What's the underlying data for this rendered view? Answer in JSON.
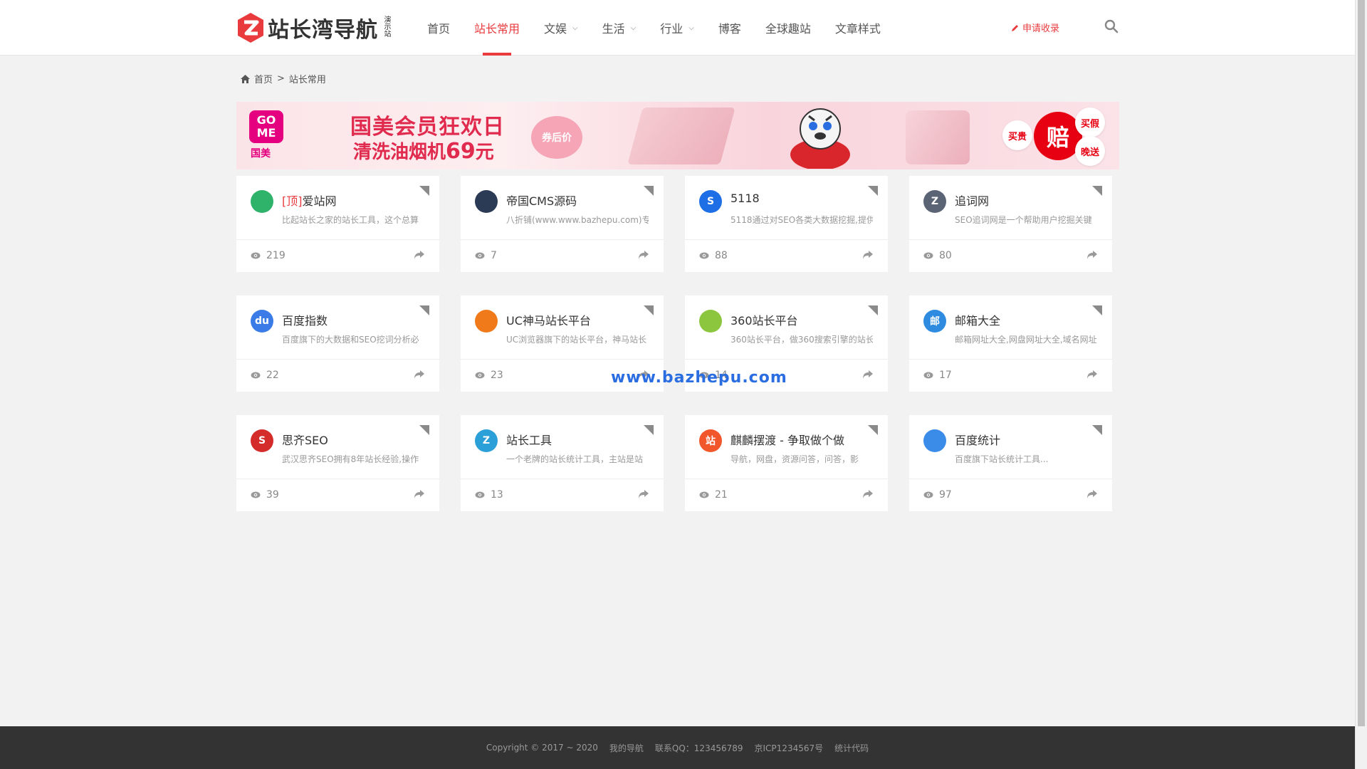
{
  "header": {
    "logo_text": "站长湾导航",
    "logo_sub": "演示站",
    "nav": [
      {
        "label": "首页",
        "active": false,
        "dropdown": false
      },
      {
        "label": "站长常用",
        "active": true,
        "dropdown": false
      },
      {
        "label": "文娱",
        "active": false,
        "dropdown": true
      },
      {
        "label": "生活",
        "active": false,
        "dropdown": true
      },
      {
        "label": "行业",
        "active": false,
        "dropdown": true
      },
      {
        "label": "博客",
        "active": false,
        "dropdown": false
      },
      {
        "label": "全球趣站",
        "active": false,
        "dropdown": false
      },
      {
        "label": "文章样式",
        "active": false,
        "dropdown": false
      }
    ],
    "apply_label": "申请收录",
    "accent_color": "#e93b3d"
  },
  "breadcrumb": {
    "home": "首页",
    "separator": ">",
    "current": "站长常用"
  },
  "banner": {
    "brand_logo": "GO\nME",
    "brand_name": "国美",
    "line1": "国美会员狂欢日",
    "line2_text": "清洗油烟机",
    "line2_price": "69",
    "line2_unit": "元",
    "coupon": "券后价",
    "badge_main": "赔",
    "badge_left": "买贵",
    "badge_right_top": "买假",
    "badge_right_bottom": "晚送"
  },
  "cards": [
    {
      "top_tag": "[顶]",
      "title": "爱站网",
      "desc": "比起站长之家的站长工具，这个总算",
      "views": "219",
      "icon": "aizhan-icon",
      "icon_text": "",
      "icon_color": "#2fb36b"
    },
    {
      "top_tag": "",
      "title": "帝国CMS源码",
      "desc": "八折铺(www.www.bazhepu.com)专",
      "views": "7",
      "icon": "empire-cms-icon",
      "icon_text": "",
      "icon_color": "#2b3a55"
    },
    {
      "top_tag": "",
      "title": "5118",
      "desc": "5118通过对SEO各类大数据挖掘,提供",
      "views": "88",
      "icon": "5118-icon",
      "icon_text": "S",
      "icon_color": "#1e6ee6"
    },
    {
      "top_tag": "",
      "title": "追词网",
      "desc": "SEO追词网是一个帮助用户挖掘关键",
      "views": "80",
      "icon": "zhuici-icon",
      "icon_text": "Z",
      "icon_color": "#5b6475"
    },
    {
      "top_tag": "",
      "title": "百度指数",
      "desc": "百度旗下的大数据和SEO挖词分析必",
      "views": "22",
      "icon": "baidu-paw-icon",
      "icon_text": "du",
      "icon_color": "#3b7be8"
    },
    {
      "top_tag": "",
      "title": "UC神马站长平台",
      "desc": "UC浏览器旗下的站长平台，神马站长",
      "views": "23",
      "icon": "uc-shenma-icon",
      "icon_text": "",
      "icon_color": "#f07a1a"
    },
    {
      "top_tag": "",
      "title": "360站长平台",
      "desc": "360站长平台，做360搜索引擎的站长",
      "views": "14",
      "icon": "360-icon",
      "icon_text": "",
      "icon_color": "#8cc63f"
    },
    {
      "top_tag": "",
      "title": "邮箱大全",
      "desc": "邮箱网址大全,网盘网址大全,域名网址",
      "views": "17",
      "icon": "mail-icon",
      "icon_text": "邮",
      "icon_color": "#2f8be0"
    },
    {
      "top_tag": "",
      "title": "思齐SEO",
      "desc": "武汉思齐SEO拥有8年站长经验,操作",
      "views": "39",
      "icon": "siqi-seo-icon",
      "icon_text": "S",
      "icon_color": "#d42b2b"
    },
    {
      "top_tag": "",
      "title": "站长工具",
      "desc": "一个老牌的站长统计工具，主站是站",
      "views": "13",
      "icon": "chinaz-icon",
      "icon_text": "Z",
      "icon_color": "#2a9fd8"
    },
    {
      "top_tag": "",
      "title": "麒麟摆渡 - 争取做个做",
      "desc": "导航，网盘，资源问答，问答，影",
      "views": "21",
      "icon": "qilin-icon",
      "icon_text": "站",
      "icon_color": "#f2562b"
    },
    {
      "top_tag": "",
      "title": "百度统计",
      "desc": "百度旗下站长统计工具...",
      "views": "97",
      "icon": "baidu-tongji-icon",
      "icon_text": "",
      "icon_color": "#3b8be8"
    }
  ],
  "watermark": "www.bazhepu.com",
  "footer": {
    "copyright": "Copyright © 2017 ~ 2020",
    "my_nav": "我的导航",
    "contact": "联系QQ：123456789",
    "icp": "京ICP1234567号",
    "stats": "统计代码"
  }
}
